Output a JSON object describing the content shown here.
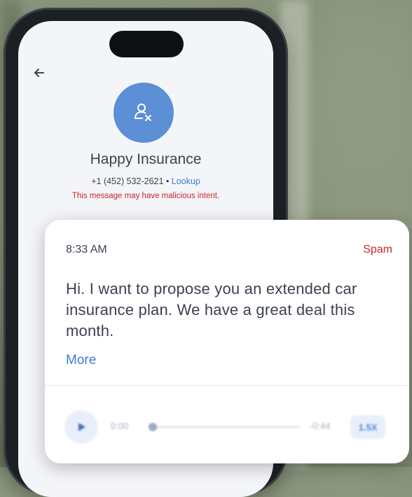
{
  "contact": {
    "name": "Happy Insurance",
    "phone": "+1 (452) 532-2621",
    "separator": " • ",
    "lookup_label": "Lookup",
    "warning": "This message may have malicious intent.",
    "avatar_icon": "unknown-contact-icon"
  },
  "message": {
    "time": "8:33 AM",
    "label": "Spam",
    "text": "Hi. I want to propose you an extended car insurance plan. We have a great deal this month.",
    "more_label": "More"
  },
  "audio": {
    "current_time": "0:00",
    "remaining_time": "-0:44",
    "speed": "1.5X",
    "progress": 0
  },
  "colors": {
    "accent": "#3d7bd4",
    "avatar": "#5b8fd6",
    "spam": "#c62828",
    "text": "#3c4252"
  }
}
